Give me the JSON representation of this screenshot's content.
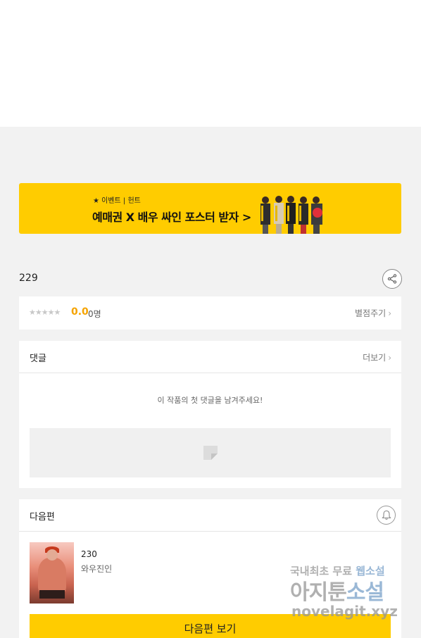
{
  "banner": {
    "tag": "★ 이벤트 | 헌트",
    "title": "예매권 X 배우 싸인 포스터 받자 >",
    "colors": {
      "background": "#ffcc00"
    }
  },
  "episode": {
    "title": "229",
    "share_icon": "share-icon"
  },
  "rating": {
    "stars": "★★★★★",
    "score": "0.0",
    "count": "0명",
    "rate_link": "별점주기"
  },
  "comments": {
    "title": "댓글",
    "more_label": "더보기",
    "empty_message": "이 작품의 첫 댓글을 남겨주세요!"
  },
  "next": {
    "title": "다음편",
    "bell_icon": "bell-icon",
    "episode_number": "230",
    "author": "와우진인",
    "button_label": "다음편 보기",
    "accent_color": "#ffcc00"
  },
  "watermark": {
    "line1_prefix": "국내최초 무료 ",
    "line1_highlight": "웹소설",
    "line2_prefix": "아지툰",
    "line2_highlight": "소설",
    "line3": "novelagit.xyz"
  }
}
